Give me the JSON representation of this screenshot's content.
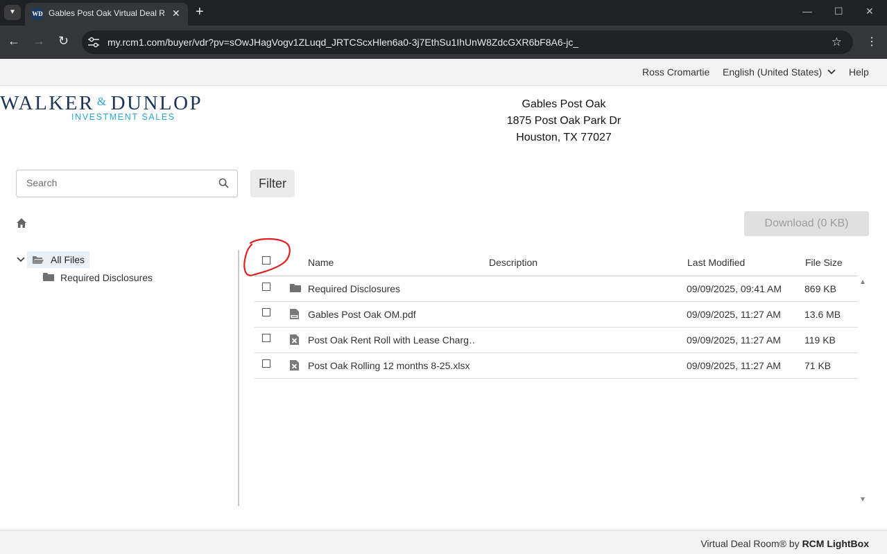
{
  "browser": {
    "tab_title": "Gables Post Oak Virtual Deal Room",
    "favicon_text": "WD",
    "url": "my.rcm1.com/buyer/vdr?pv=sOwJHagVogv1ZLuqd_JRTCScxHlen6a0-3j7EthSu1IhUnW8ZdcGXR6bF8A6-jc_"
  },
  "header": {
    "user_name": "Ross Cromartie",
    "language": "English (United States)",
    "help": "Help"
  },
  "logo": {
    "left": "WALKER",
    "amp": "&",
    "right": "DUNLOP",
    "subtitle": "INVESTMENT SALES"
  },
  "property": {
    "name": "Gables Post Oak",
    "address_line1": "1875 Post Oak Park Dr",
    "address_line2": "Houston, TX 77027"
  },
  "search": {
    "placeholder": "Search"
  },
  "filter_label": "Filter",
  "download_label": "Download (0 KB)",
  "tree": {
    "root_label": "All Files",
    "children": [
      "Required Disclosures"
    ]
  },
  "table": {
    "headers": {
      "name": "Name",
      "description": "Description",
      "last_modified": "Last Modified",
      "file_size": "File Size"
    },
    "rows": [
      {
        "type": "folder",
        "name": "Required Disclosures",
        "description": "",
        "last_modified": "09/09/2025, 09:41 AM",
        "size": "869 KB"
      },
      {
        "type": "pdf",
        "name": "Gables Post Oak OM.pdf",
        "description": "",
        "last_modified": "09/09/2025, 11:27 AM",
        "size": "13.6 MB"
      },
      {
        "type": "xlsx",
        "name": "Post Oak Rent Roll with Lease Charg…",
        "description": "",
        "last_modified": "09/09/2025, 11:27 AM",
        "size": "119 KB"
      },
      {
        "type": "xlsx",
        "name": "Post Oak Rolling 12 months 8-25.xlsx",
        "description": "",
        "last_modified": "09/09/2025, 11:27 AM",
        "size": "71 KB"
      }
    ]
  },
  "footer": {
    "prefix": "Virtual Deal Room® by ",
    "brand": "RCM LightBox"
  },
  "colors": {
    "annotation": "#e02020",
    "logo_navy": "#1c3557",
    "logo_blue": "#2aa9d6"
  }
}
